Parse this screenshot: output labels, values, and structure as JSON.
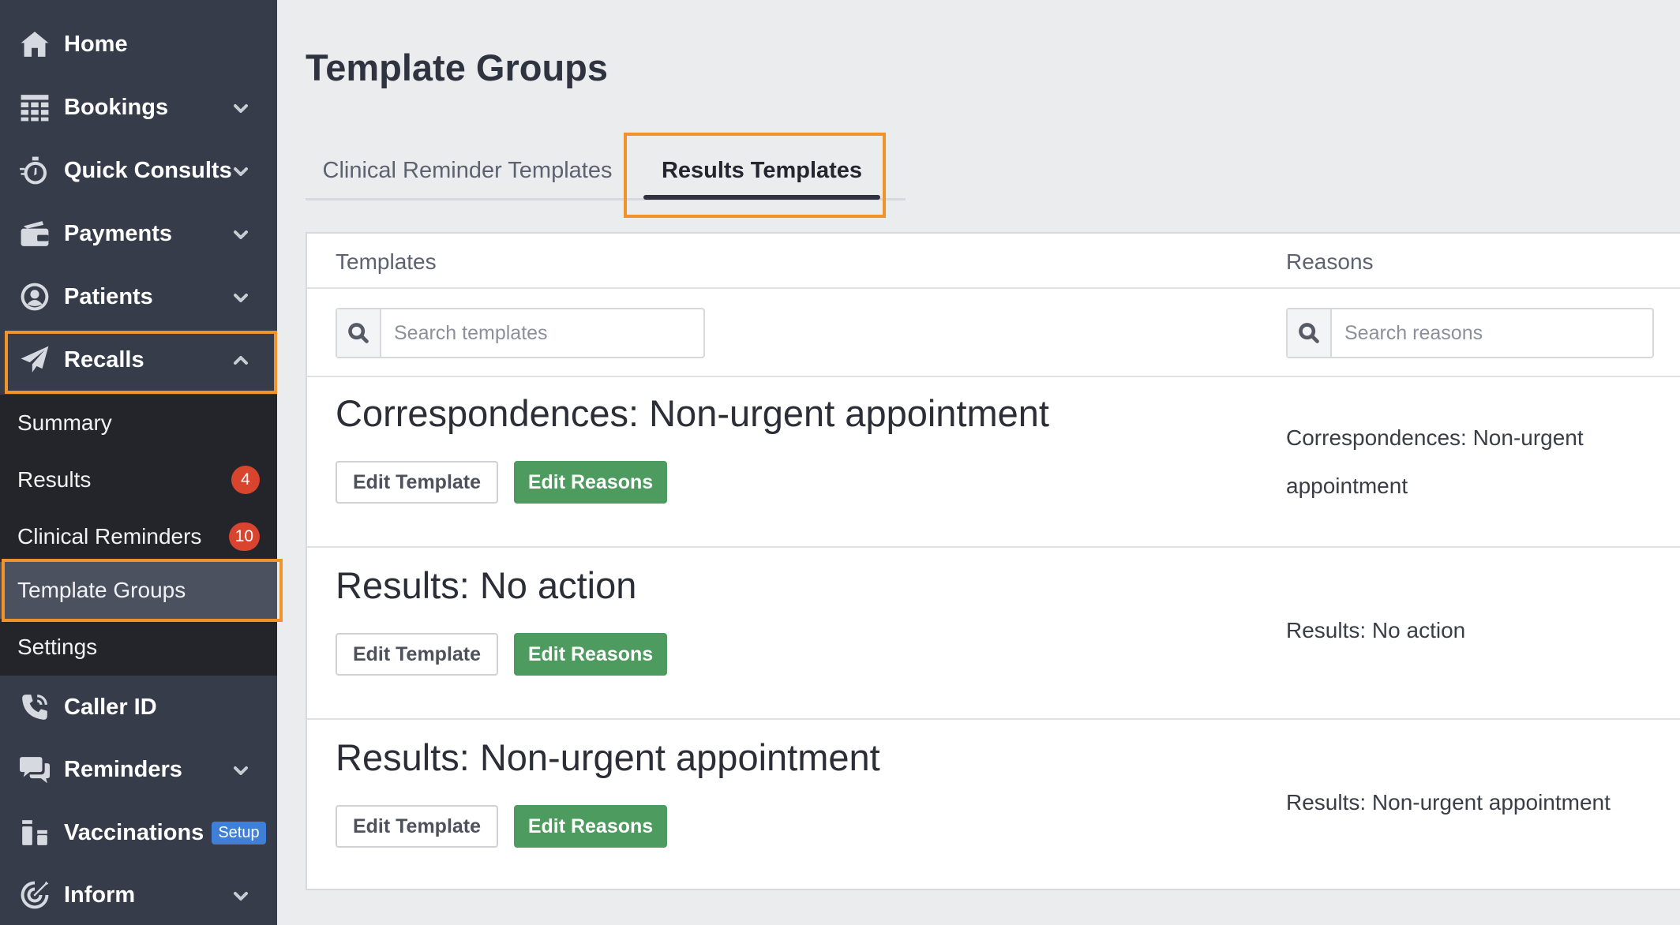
{
  "sidebar": {
    "nav": [
      {
        "label": "Home",
        "icon": "home-icon",
        "has_chevron": false
      },
      {
        "label": "Bookings",
        "icon": "calendar-grid-icon",
        "has_chevron": true
      },
      {
        "label": "Quick Consults",
        "icon": "stopwatch-icon",
        "has_chevron": true
      },
      {
        "label": "Payments",
        "icon": "wallet-icon",
        "has_chevron": true
      },
      {
        "label": "Patients",
        "icon": "user-circle-icon",
        "has_chevron": true
      },
      {
        "label": "Recalls",
        "icon": "paper-plane-icon",
        "has_chevron": true,
        "expanded": true
      }
    ],
    "recalls_sub": [
      {
        "label": "Summary"
      },
      {
        "label": "Results",
        "badge": "4"
      },
      {
        "label": "Clinical Reminders",
        "badge": "10"
      },
      {
        "label": "Template Groups",
        "active": true
      },
      {
        "label": "Settings"
      }
    ],
    "nav_bottom": [
      {
        "label": "Caller ID",
        "icon": "phone-icon",
        "has_chevron": false
      },
      {
        "label": "Reminders",
        "icon": "chat-bubbles-icon",
        "has_chevron": true
      },
      {
        "label": "Vaccinations",
        "icon": "vials-icon",
        "badge": "Setup"
      },
      {
        "label": "Inform",
        "icon": "target-icon",
        "has_chevron": true
      }
    ]
  },
  "main": {
    "title": "Template Groups",
    "tabs": [
      {
        "label": "Clinical Reminder Templates",
        "active": false
      },
      {
        "label": "Results Templates",
        "active": true
      }
    ],
    "table": {
      "col_templates": "Templates",
      "col_reasons": "Reasons",
      "search_templates_placeholder": "Search templates",
      "search_reasons_placeholder": "Search reasons",
      "rows": [
        {
          "title": "Correspondences: Non-urgent appointment",
          "reason": "Correspondences: Non-urgent appointment"
        },
        {
          "title": "Results: No action",
          "reason": "Results: No action"
        },
        {
          "title": "Results: Non-urgent appointment",
          "reason": "Results: Non-urgent appointment"
        }
      ],
      "edit_template_label": "Edit Template",
      "edit_reasons_label": "Edit Reasons"
    }
  },
  "colors": {
    "sidebar_bg": "#363c4a",
    "subnav_bg": "#23252b",
    "highlight": "#f0932b",
    "badge_red": "#d9442e",
    "badge_blue": "#3f7fd7",
    "button_green": "#4d9b5e"
  }
}
